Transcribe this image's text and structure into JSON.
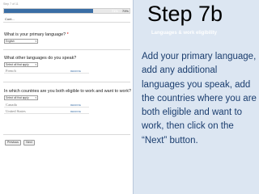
{
  "form": {
    "step_counter": "Step 7 of 11",
    "progress": {
      "fill_percent": 71,
      "label": "71%",
      "label_right": "71%"
    },
    "user_label": "Cont...",
    "q1": {
      "label": "What is your primary language?",
      "required_mark": "*",
      "selected": "English"
    },
    "q2": {
      "label": "What other languages do you speak?",
      "select_placeholder": "Select all that apply"
    },
    "other_languages": [
      {
        "name": "French",
        "action": "REMOVE"
      }
    ],
    "q3": {
      "label": "In which countries are you both eligible to work and want to work?",
      "select_placeholder": "Select all that apply"
    },
    "countries": [
      {
        "name": "Canada",
        "action": "REMOVE"
      },
      {
        "name": "United States",
        "action": "REMOVE"
      }
    ],
    "buttons": {
      "previous": "Previous",
      "next": "Next"
    }
  },
  "panel": {
    "title": "Step 7b",
    "subtitle": "Languages & work eligibility",
    "instructions": "Add your primary language, add any additional languages you speak, add the countries where you are both eligible and want to work, then click on the “Next” button."
  },
  "colors": {
    "panel_bg": "#dce6f2",
    "instruction_text": "#1a3d6e",
    "progress_fill": "#3a6ea5"
  }
}
